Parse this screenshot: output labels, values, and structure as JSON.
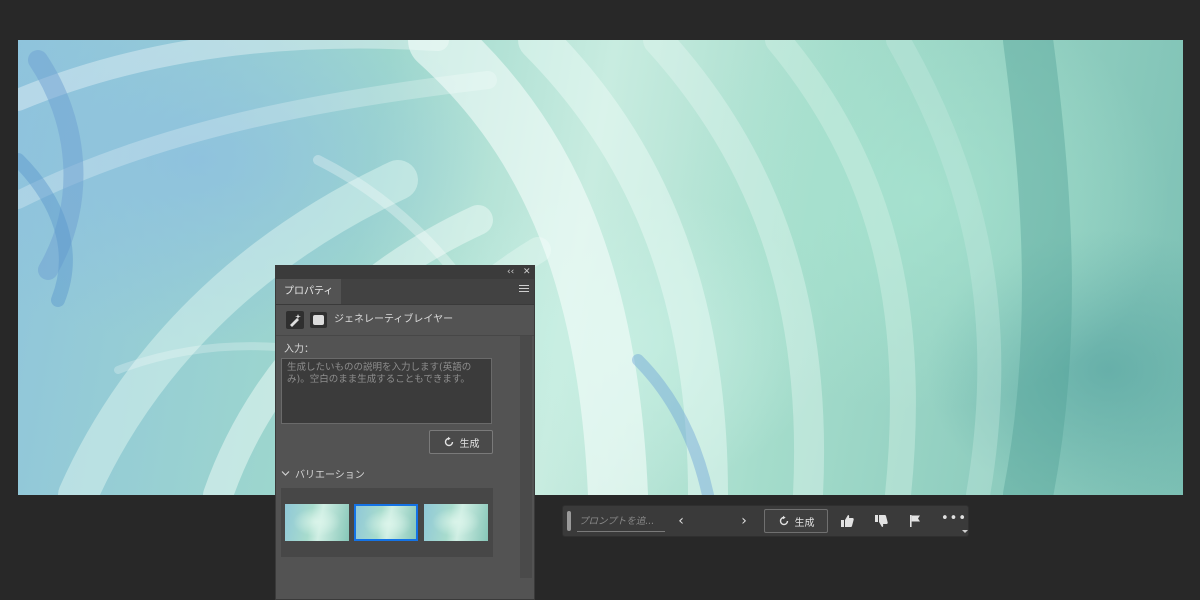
{
  "properties_panel": {
    "controls": {
      "collapse_glyph": "‹‹",
      "close_glyph": "✕"
    },
    "tab_label": "プロパティ",
    "layer": {
      "icons": [
        "generative-brush-icon",
        "layer-mask-icon"
      ],
      "label": "ジェネレーティブレイヤー"
    },
    "input_label": "入力：",
    "prompt_placeholder": "生成したいものの説明を入力します(英語のみ)。空白のまま生成することもできます。",
    "generate_button": "生成",
    "variations": {
      "header": "バリエーション",
      "thumbnail_count": 3,
      "selected_index": 1
    }
  },
  "taskbar": {
    "prompt_placeholder": "プロンプトを追...",
    "prev_glyph": "‹",
    "next_glyph": "›",
    "generate_button": "生成",
    "icons": [
      "thumbs-up-icon",
      "thumbs-down-icon",
      "flag-icon",
      "more-icon"
    ],
    "more_glyph": "•••"
  },
  "colors": {
    "app_background": "#282828",
    "panel_background": "#535353",
    "selection_accent": "#1473e6"
  }
}
